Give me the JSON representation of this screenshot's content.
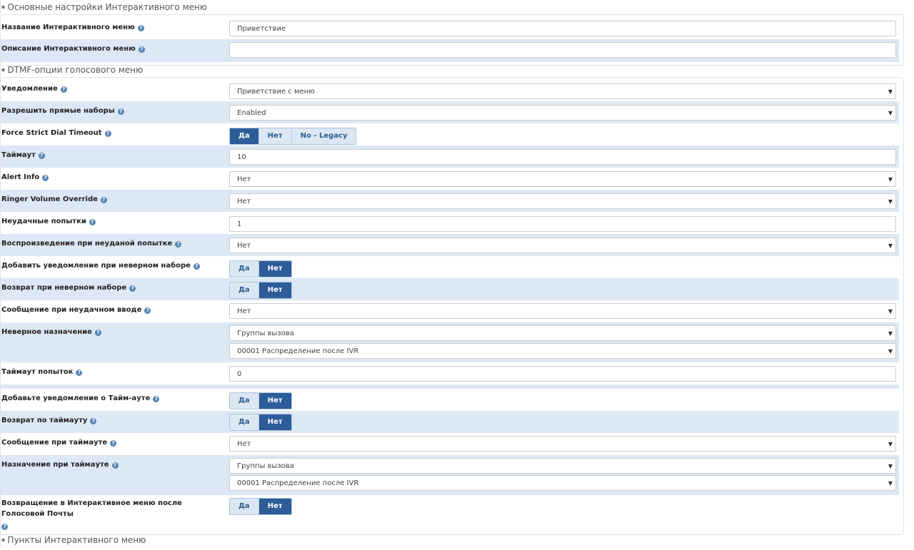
{
  "sections": {
    "basic": "Основные настройки Интерактивного меню",
    "dtmf": "DTMF-опции голосового меню",
    "entries": "Пункты Интерактивного меню"
  },
  "icons": {
    "help": "question-circle-icon",
    "dropdown": "caret-down-icon"
  },
  "help_glyph": "?",
  "arrow_glyph": "▼",
  "basic": {
    "name_label": "Название Интерактивного меню",
    "name_value": "Приветствие",
    "desc_label": "Описание Интерактивного меню",
    "desc_value": ""
  },
  "dtmf": {
    "announcement": {
      "label": "Уведомление",
      "value": "Приветствие с меню"
    },
    "direct_dial": {
      "label": "Разрешить прямые наборы",
      "value": "Enabled"
    },
    "strict_timeout": {
      "label": "Force Strict Dial Timeout",
      "options": [
        "Да",
        "Нет",
        "No - Legacy"
      ],
      "selected": "Да"
    },
    "timeout": {
      "label": "Таймаут",
      "value": "10"
    },
    "alert_info": {
      "label": "Alert Info",
      "value": "Нет"
    },
    "ringer_volume": {
      "label": "Ringer Volume Override",
      "value": "Нет"
    },
    "invalid_retries": {
      "label": "Неудачные попытки",
      "value": "1"
    },
    "invalid_retry_recording": {
      "label": "Воспроизведение при неуданой попытке",
      "value": "Нет"
    },
    "append_invalid": {
      "label": "Добавить уведомление при неверном наборе",
      "options": [
        "Да",
        "Нет"
      ],
      "selected": "Нет"
    },
    "return_invalid": {
      "label": "Возврат при неверном наборе",
      "options": [
        "Да",
        "Нет"
      ],
      "selected": "Нет"
    },
    "invalid_recording": {
      "label": "Сообщение при неудачном вводе",
      "value": "Нет"
    },
    "invalid_destination": {
      "label": "Неверное назначение",
      "value1": "Группы вызова",
      "value2": "00001 Распределение после IVR"
    },
    "timeout_retries": {
      "label": "Таймаут попыток",
      "value": "0"
    },
    "append_timeout": {
      "label": "Добавьте уведомление о Тайм-ауте",
      "options": [
        "Да",
        "Нет"
      ],
      "selected": "Нет"
    },
    "return_timeout": {
      "label": "Возврат по таймауту",
      "options": [
        "Да",
        "Нет"
      ],
      "selected": "Нет"
    },
    "timeout_recording": {
      "label": "Сообщение при таймауте",
      "value": "Нет"
    },
    "timeout_destination": {
      "label": "Назначение при таймауте",
      "value1": "Группы вызова",
      "value2": "00001 Распределение после IVR"
    },
    "return_after_vm": {
      "label": "Возвращение в Интерактивное меню после Голосовой Почты",
      "options": [
        "Да",
        "Нет"
      ],
      "selected": "Нет"
    }
  }
}
